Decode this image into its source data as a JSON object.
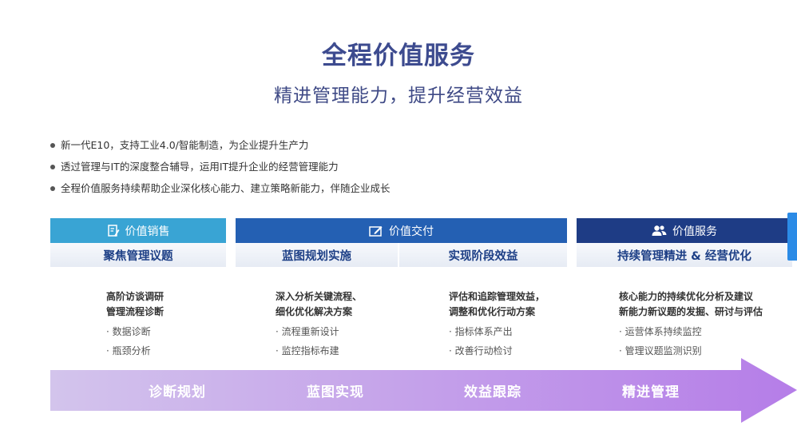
{
  "title": "全程价值服务",
  "subtitle": "精进管理能力，提升经营效益",
  "bullets": [
    "新一代E10，支持工业4.0/智能制造，为企业提升生产力",
    "透过管理与IT的深度整合辅导，运用IT提升企业的经营管理能力",
    "全程价值服务持续帮助企业深化核心能力、建立策略新能力，伴随企业成长"
  ],
  "headers": {
    "sales": {
      "label": "价值销售",
      "icon": "document-edit-icon",
      "color": "#39a4d4"
    },
    "delivery": {
      "label": "价值交付",
      "icon": "edit-box-icon",
      "color": "#2460b3"
    },
    "service": {
      "label": "价值服务",
      "icon": "users-icon",
      "color": "#1e3c85"
    }
  },
  "subheaders": [
    "聚焦管理议题",
    "蓝图规划实施",
    "实现阶段效益",
    "持续管理精进 & 经营优化"
  ],
  "columns": [
    {
      "lead1": "高阶访谈调研",
      "lead2": "管理流程诊断",
      "items": [
        "· 数据诊断",
        "· 瓶颈分析"
      ]
    },
    {
      "lead1": "深入分析关键流程、",
      "lead2": "细化优化解决方案",
      "items": [
        "· 流程重新设计",
        "· 监控指标布建"
      ]
    },
    {
      "lead1": "评估和追踪管理效益，",
      "lead2": "调整和优化行动方案",
      "items": [
        "· 指标体系产出",
        "· 改善行动检讨"
      ]
    },
    {
      "lead1": "核心能力的持续优化分析及建议",
      "lead2": "新能力新议题的发掘、研讨与评估",
      "items": [
        "· 运营体系持续监控",
        "· 管理议题监测识别"
      ]
    }
  ],
  "arrow_labels": [
    "诊断规划",
    "蓝图实现",
    "效益跟踪",
    "精进管理"
  ],
  "colors": {
    "arrow_start": "#d3c4ec",
    "arrow_end": "#b57de8",
    "title": "#3d4b8f"
  }
}
